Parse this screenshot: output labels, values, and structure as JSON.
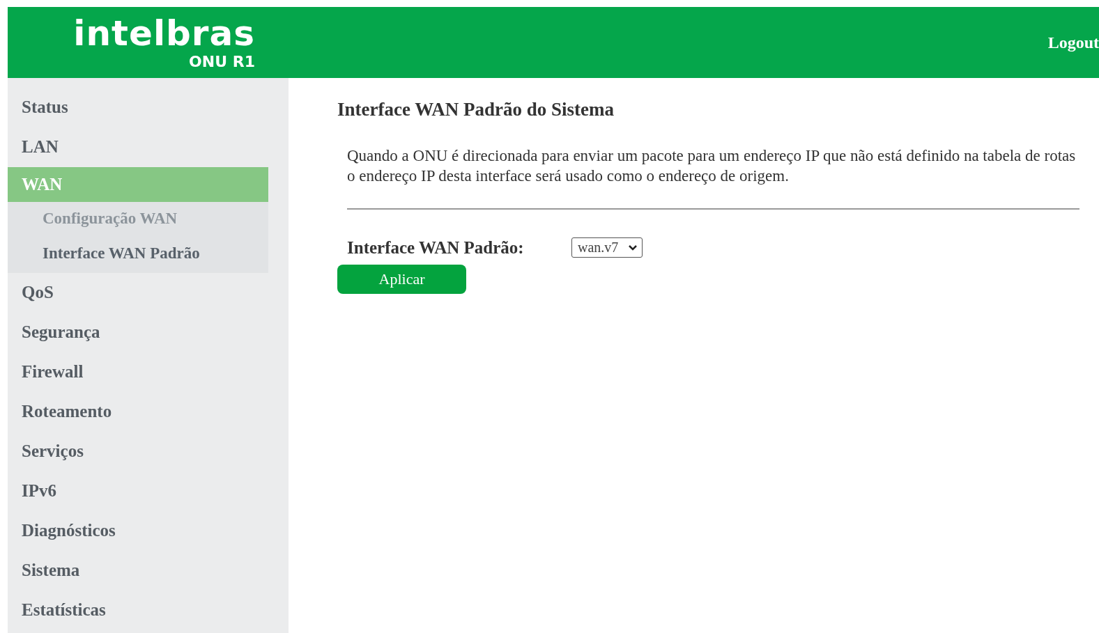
{
  "header": {
    "logo": {
      "brand": "intelbras",
      "model": "ONU R1"
    },
    "logout": "Logout"
  },
  "sidebar": {
    "items": [
      {
        "label": "Status",
        "selected": false
      },
      {
        "label": "LAN",
        "selected": false
      },
      {
        "label": "WAN",
        "selected": true,
        "expanded": true,
        "children": [
          {
            "label": "Configuração WAN",
            "selected": false
          },
          {
            "label": "Interface WAN Padrão",
            "selected": true
          }
        ]
      },
      {
        "label": "QoS",
        "selected": false
      },
      {
        "label": "Segurança",
        "selected": false
      },
      {
        "label": "Firewall",
        "selected": false
      },
      {
        "label": "Roteamento",
        "selected": false
      },
      {
        "label": "Serviços",
        "selected": false
      },
      {
        "label": "IPv6",
        "selected": false
      },
      {
        "label": "Diagnósticos",
        "selected": false
      },
      {
        "label": "Sistema",
        "selected": false
      },
      {
        "label": "Estatísticas",
        "selected": false
      }
    ]
  },
  "main": {
    "title": "Interface WAN Padrão do Sistema",
    "description": "Quando a ONU é direcionada para enviar um pacote para um endereço IP que não está definido na tabela de rotas o endereço IP desta interface será usado como o endereço de origem.",
    "field": {
      "label": "Interface WAN Padrão:",
      "value": "wan.v7"
    },
    "button": "Aplicar"
  }
}
